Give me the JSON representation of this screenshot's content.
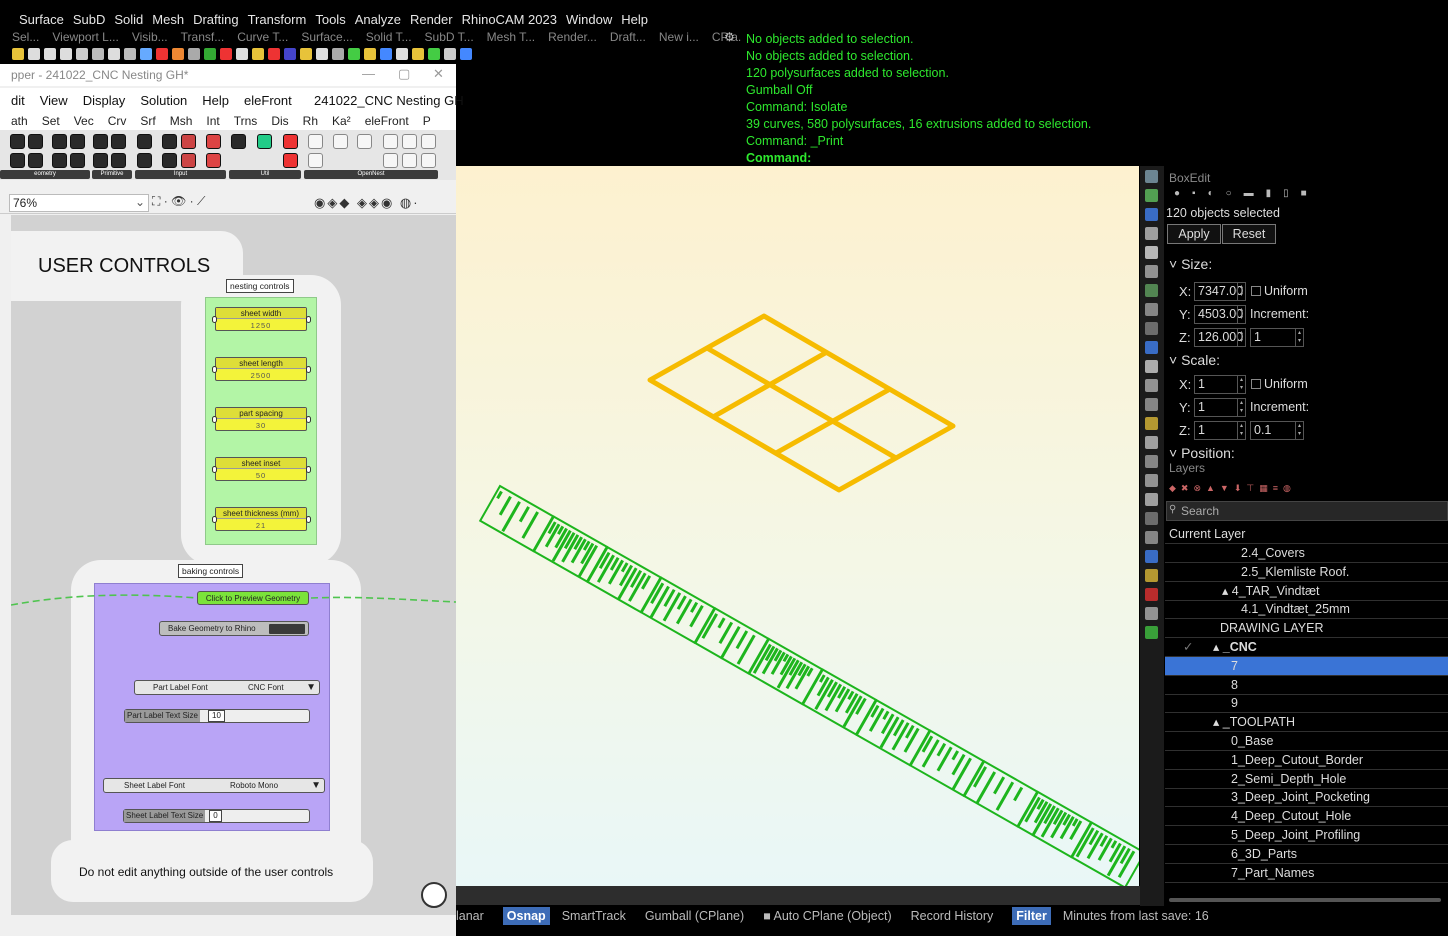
{
  "menubar": [
    "Surface",
    "SubD",
    "Solid",
    "Mesh",
    "Drafting",
    "Transform",
    "Tools",
    "Analyze",
    "Render",
    "RhinoCAM 2023",
    "Window",
    "Help"
  ],
  "toolbar_tabs": [
    "Sel...",
    "Viewport L...",
    "Visib...",
    "Transf...",
    "Curve T...",
    "Surface...",
    "Solid T...",
    "SubD T...",
    "Mesh T...",
    "Render...",
    "Draft...",
    "New i...",
    "CPla..."
  ],
  "command_history": [
    "No objects added to selection.",
    "No objects added to selection.",
    "120 polysurfaces added to selection.",
    "Gumball Off",
    "Command: Isolate",
    "39 curves, 580 polysurfaces, 16 extrusions added to selection.",
    "Command: _Print",
    "Command:"
  ],
  "grasshopper": {
    "title": "pper - 241022_CNC Nesting GH*",
    "menu": [
      "dit",
      "View",
      "Display",
      "Solution",
      "Help",
      "eleFront"
    ],
    "doc_name": "241022_CNC Nesting GH",
    "ribbon": [
      "ath",
      "Set",
      "Vec",
      "Crv",
      "Srf",
      "Msh",
      "Int",
      "Trns",
      "Dis",
      "Rh",
      "Ka²",
      "eleFront",
      "P"
    ],
    "categories": [
      "eometry",
      "Primitive",
      "Input",
      "Util",
      "OpenNest"
    ],
    "zoom": "76%",
    "canvas": {
      "user_controls_title": "USER CONTROLS",
      "nesting_tag": "nesting controls",
      "sliders": [
        {
          "label": "sheet width",
          "value": "1250"
        },
        {
          "label": "sheet length",
          "value": "2500"
        },
        {
          "label": "part spacing",
          "value": "30"
        },
        {
          "label": "sheet inset",
          "value": "50"
        },
        {
          "label": "sheet thickness (mm)",
          "value": "21"
        }
      ],
      "baking_tag": "baking controls",
      "preview_button": "Click to Preview Geometry",
      "bake_button": "Bake Geometry to Rhino",
      "part_label_font": {
        "label": "Part Label Font",
        "value": "CNC Font"
      },
      "part_label_size": {
        "label": "Part Label Text Size",
        "value": "10"
      },
      "sheet_label_font": {
        "label": "Sheet Label Font",
        "value": "Roboto Mono"
      },
      "sheet_label_size": {
        "label": "Sheet Label Text Size",
        "value": "0"
      },
      "footer_note": "Do not edit anything outside of the user controls"
    }
  },
  "statusbar": {
    "items": [
      {
        "label": "lanar",
        "on": false
      },
      {
        "label": "Osnap",
        "on": true
      },
      {
        "label": "SmartTrack",
        "on": false
      },
      {
        "label": "Gumball (CPlane)",
        "on": false
      },
      {
        "label": "■ Auto CPlane (Object)",
        "on": false
      },
      {
        "label": "Record History",
        "on": false
      },
      {
        "label": "Filter",
        "on": true
      },
      {
        "label": "Minutes from last save: 16",
        "on": false
      }
    ]
  },
  "boxedit": {
    "title": "BoxEdit",
    "selection": "120 objects selected",
    "apply": "Apply",
    "reset": "Reset",
    "size_section": "Size:",
    "size": {
      "x": "7347.00",
      "y": "4503.00",
      "z": "126.000",
      "increment": "1"
    },
    "scale_section": "Scale:",
    "scale": {
      "x": "1",
      "y": "1",
      "z": "1",
      "increment": "0.1"
    },
    "uniform": "Uniform",
    "increment_label": "Increment:",
    "position_section": "Position:"
  },
  "layers": {
    "title": "Layers",
    "search_placeholder": "Search",
    "current_header": "Current Layer",
    "rows": [
      {
        "name": "2.4_Covers",
        "indent": 76,
        "selected": false
      },
      {
        "name": "2.5_Klemliste Roof.",
        "indent": 76,
        "selected": false
      },
      {
        "name": "▴ 4_TAR_Vindtæt",
        "indent": 57,
        "selected": false
      },
      {
        "name": "4.1_Vindtæt_25mm",
        "indent": 76,
        "selected": false
      },
      {
        "name": "DRAWING LAYER",
        "indent": 55,
        "selected": false
      },
      {
        "name": "▴ _CNC",
        "indent": 48,
        "selected": false,
        "current": true
      },
      {
        "name": "7",
        "indent": 66,
        "selected": true
      },
      {
        "name": "8",
        "indent": 66,
        "selected": false
      },
      {
        "name": "9",
        "indent": 66,
        "selected": false
      },
      {
        "name": "▴ _TOOLPATH",
        "indent": 48,
        "selected": false
      },
      {
        "name": "0_Base",
        "indent": 66,
        "selected": false
      },
      {
        "name": "1_Deep_Cutout_Border",
        "indent": 66,
        "selected": false
      },
      {
        "name": "2_Semi_Depth_Hole",
        "indent": 66,
        "selected": false
      },
      {
        "name": "3_Deep_Joint_Pocketing",
        "indent": 66,
        "selected": false
      },
      {
        "name": "4_Deep_Cutout_Hole",
        "indent": 66,
        "selected": false
      },
      {
        "name": "5_Deep_Joint_Profiling",
        "indent": 66,
        "selected": false
      },
      {
        "name": "6_3D_Parts",
        "indent": 66,
        "selected": false
      },
      {
        "name": "7_Part_Names",
        "indent": 66,
        "selected": false
      }
    ]
  },
  "colors": {
    "command_text": "#2ee82e",
    "nested_parts": "#1db51d",
    "sheet_frame": "#f6bb00",
    "layer_selected": "#3a74d6",
    "slider": "#f3f33a",
    "nesting_group": "#b3f5a6",
    "baking_group": "#b9a4f6"
  }
}
